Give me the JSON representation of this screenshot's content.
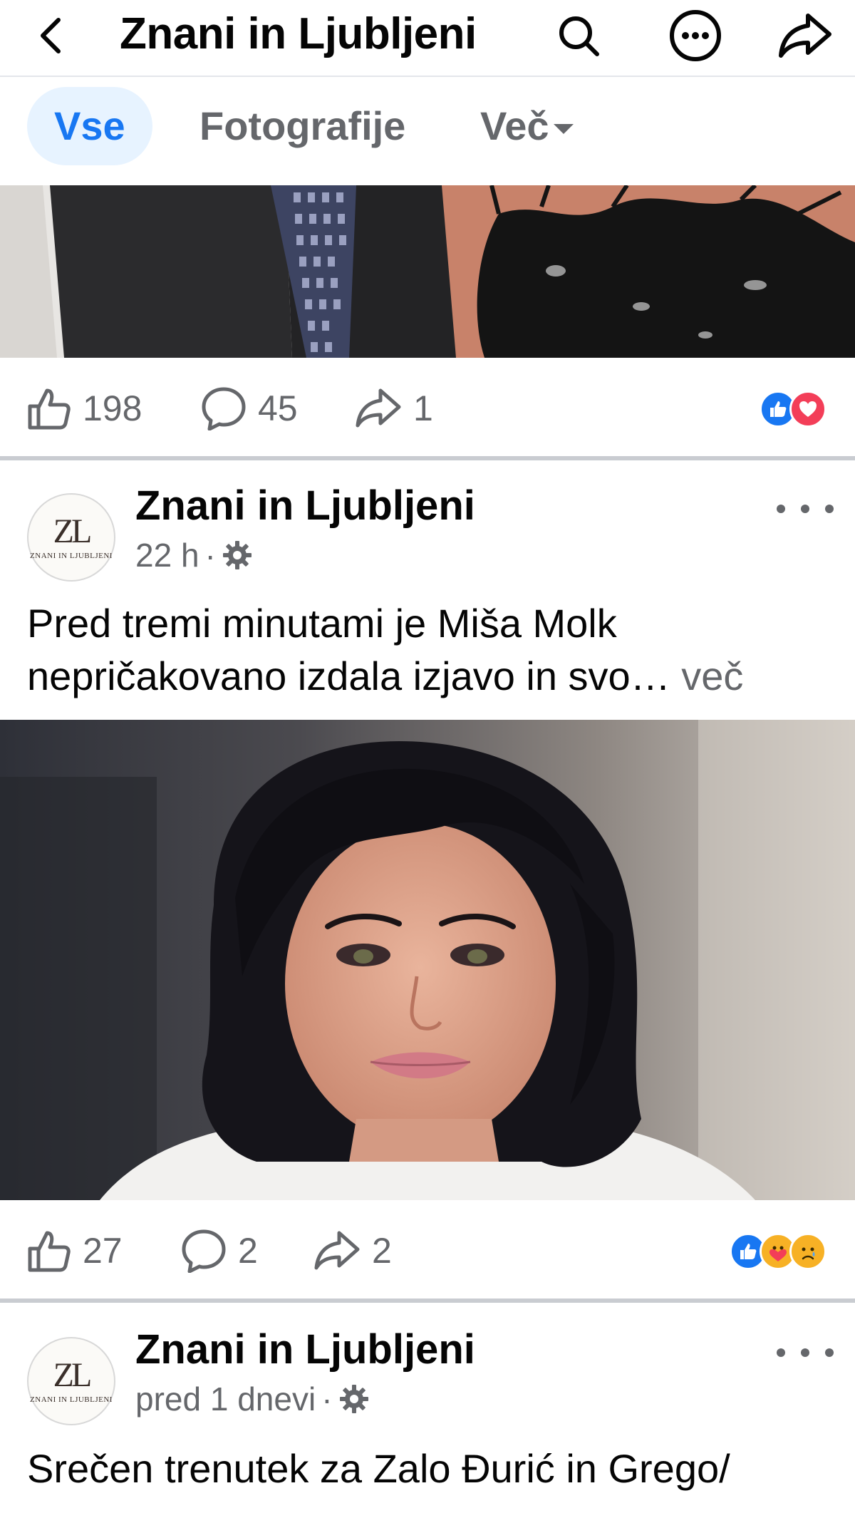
{
  "header": {
    "title": "Znani in Ljubljeni",
    "icons": [
      "back-arrow-icon",
      "search-icon",
      "more-options-icon",
      "share-icon"
    ]
  },
  "tabs": [
    {
      "label": "Vse",
      "active": true
    },
    {
      "label": "Fotografije",
      "active": false
    },
    {
      "label": "Več",
      "active": false
    }
  ],
  "post_prev": {
    "likes": "198",
    "comments": "45",
    "shares": "1",
    "reactions": [
      "like",
      "love"
    ]
  },
  "post1": {
    "page_name": "Znani in Ljubljeni",
    "avatar_monogram": "ZL",
    "avatar_text": "ZNANI IN LJUBLJENI",
    "time": "22 h",
    "separator": "·",
    "text": "Pred tremi minutami je Miša Molk nepričakovano izdala izjavo in svo…",
    "more_label": "več",
    "likes": "27",
    "comments": "2",
    "shares": "2",
    "reactions": [
      "like",
      "care",
      "sad"
    ]
  },
  "post2": {
    "page_name": "Znani in Ljubljeni",
    "avatar_monogram": "ZL",
    "avatar_text": "ZNANI IN LJUBLJENI",
    "time": "pred 1 dnevi",
    "separator": "·",
    "text": "Srečen trenutek za Zalo Đurić in Grego/"
  },
  "colors": {
    "accent": "#1877f2",
    "tab_active_bg": "#e7f3ff",
    "secondary_text": "#65676b",
    "love": "#f33e58",
    "care_sad": "#f7b125"
  }
}
